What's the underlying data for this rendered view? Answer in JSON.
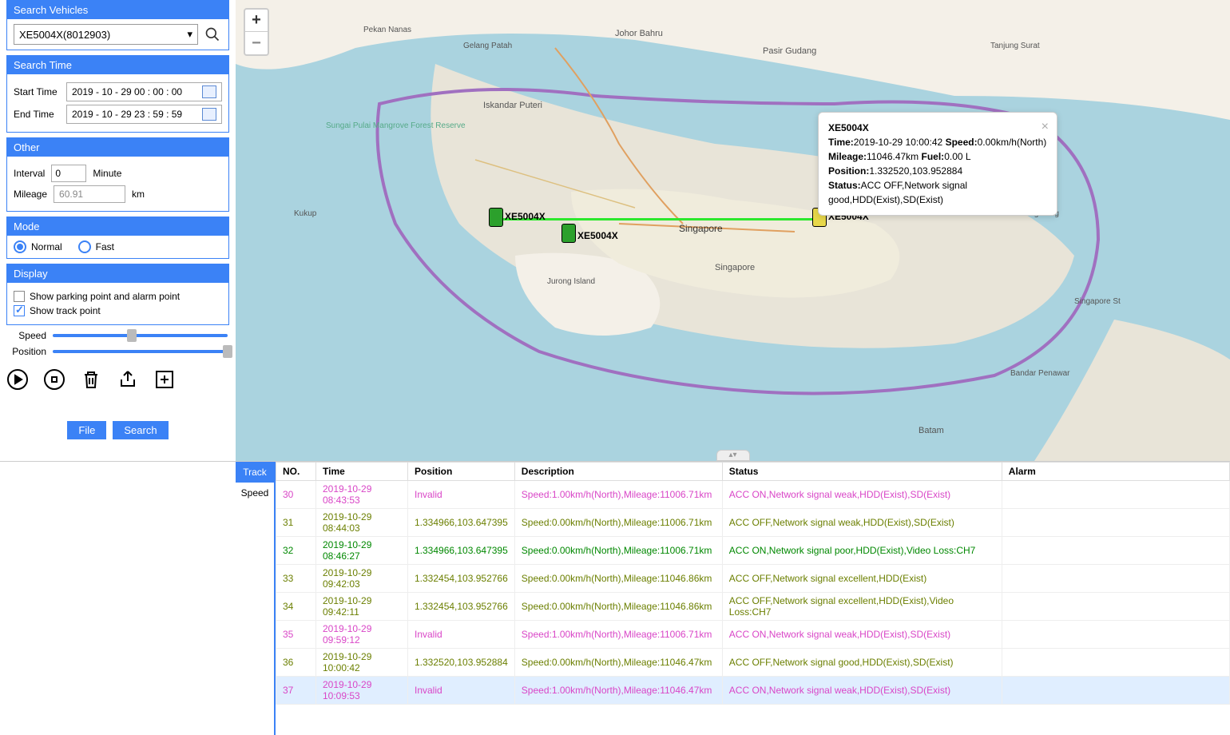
{
  "sidebar": {
    "search_vehicles_title": "Search Vehicles",
    "vehicle_selected": "XE5004X(8012903)",
    "search_time_title": "Search Time",
    "start_time_label": "Start Time",
    "start_time_value": "2019 - 10 - 29 00 : 00 : 00",
    "end_time_label": "End Time",
    "end_time_value": "2019 - 10 - 29 23 : 59 : 59",
    "other_title": "Other",
    "interval_label": "Interval",
    "interval_value": "0",
    "minute_label": "Minute",
    "mileage_label": "Mileage",
    "mileage_value": "60.91",
    "km_label": "km",
    "mode_title": "Mode",
    "mode_normal": "Normal",
    "mode_fast": "Fast",
    "display_title": "Display",
    "display_parking": "Show parking point and alarm point",
    "display_track": "Show track point",
    "speed_label": "Speed",
    "position_label": "Position",
    "file_btn": "File",
    "search_btn": "Search"
  },
  "map": {
    "vehicle_label": "XE5004X",
    "popup": {
      "title": "XE5004X",
      "time_label": "Time:",
      "time_value": "2019-10-29 10:00:42",
      "speed_label": "Speed:",
      "speed_value": "0.00km/h(North)",
      "mileage_label": "Mileage:",
      "mileage_value": "11046.47km",
      "fuel_label": "Fuel:",
      "fuel_value": "0.00 L",
      "position_label": "Position:",
      "position_value": "1.332520,103.952884",
      "status_label": "Status:",
      "status_value": "ACC OFF,Network signal good,HDD(Exist),SD(Exist)"
    }
  },
  "tabs": {
    "track": "Track",
    "speed": "Speed"
  },
  "table": {
    "headers": {
      "no": "NO.",
      "time": "Time",
      "position": "Position",
      "description": "Description",
      "status": "Status",
      "alarm": "Alarm"
    },
    "rows": [
      {
        "no": "30",
        "time": "2019-10-29 08:43:53",
        "position": "Invalid",
        "description": "Speed:1.00km/h(North),Mileage:11006.71km",
        "status": "ACC ON,Network signal weak,HDD(Exist),SD(Exist)",
        "alarm": "",
        "cls": "row-pink"
      },
      {
        "no": "31",
        "time": "2019-10-29 08:44:03",
        "position": "1.334966,103.647395",
        "description": "Speed:0.00km/h(North),Mileage:11006.71km",
        "status": "ACC OFF,Network signal weak,HDD(Exist),SD(Exist)",
        "alarm": "",
        "cls": "row-olive"
      },
      {
        "no": "32",
        "time": "2019-10-29 08:46:27",
        "position": "1.334966,103.647395",
        "description": "Speed:0.00km/h(North),Mileage:11006.71km",
        "status": "ACC ON,Network signal poor,HDD(Exist),Video Loss:CH7",
        "alarm": "",
        "cls": "row-green"
      },
      {
        "no": "33",
        "time": "2019-10-29 09:42:03",
        "position": "1.332454,103.952766",
        "description": "Speed:0.00km/h(North),Mileage:11046.86km",
        "status": "ACC OFF,Network signal excellent,HDD(Exist)",
        "alarm": "",
        "cls": "row-olive"
      },
      {
        "no": "34",
        "time": "2019-10-29 09:42:11",
        "position": "1.332454,103.952766",
        "description": "Speed:0.00km/h(North),Mileage:11046.86km",
        "status": "ACC OFF,Network signal excellent,HDD(Exist),Video Loss:CH7",
        "alarm": "",
        "cls": "row-olive"
      },
      {
        "no": "35",
        "time": "2019-10-29 09:59:12",
        "position": "Invalid",
        "description": "Speed:1.00km/h(North),Mileage:11006.71km",
        "status": "ACC ON,Network signal weak,HDD(Exist),SD(Exist)",
        "alarm": "",
        "cls": "row-pink"
      },
      {
        "no": "36",
        "time": "2019-10-29 10:00:42",
        "position": "1.332520,103.952884",
        "description": "Speed:0.00km/h(North),Mileage:11046.47km",
        "status": "ACC OFF,Network signal good,HDD(Exist),SD(Exist)",
        "alarm": "",
        "cls": "row-olive"
      },
      {
        "no": "37",
        "time": "2019-10-29 10:09:53",
        "position": "Invalid",
        "description": "Speed:1.00km/h(North),Mileage:11046.47km",
        "status": "ACC ON,Network signal weak,HDD(Exist),SD(Exist)",
        "alarm": "",
        "cls": "row-pink selected"
      }
    ]
  }
}
